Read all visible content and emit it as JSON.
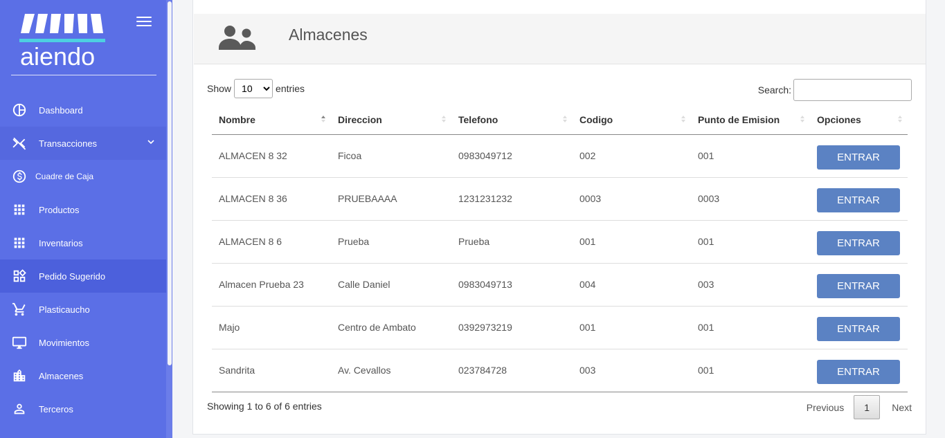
{
  "sidebar": {
    "logo_text": "aiendo",
    "items": [
      {
        "label": "Dashboard",
        "icon": "dashboard-icon"
      },
      {
        "label": "Transacciones",
        "icon": "transactions-icon"
      },
      {
        "label": "Cuadre de Caja",
        "icon": "dollar-icon"
      },
      {
        "label": "Productos",
        "icon": "grid-icon"
      },
      {
        "label": "Inventarios",
        "icon": "grid-icon"
      },
      {
        "label": "Pedido Sugerido",
        "icon": "widgets-icon"
      },
      {
        "label": "Plasticaucho",
        "icon": "cart-icon"
      },
      {
        "label": "Movimientos",
        "icon": "monitor-icon"
      },
      {
        "label": "Almacenes",
        "icon": "building-icon"
      },
      {
        "label": "Terceros",
        "icon": "person-icon"
      }
    ]
  },
  "header": {
    "title": "Almacenes",
    "icon": "users-icon"
  },
  "controls": {
    "show_label": "Show",
    "entries_label": "entries",
    "length_value": "10",
    "search_label": "Search:",
    "search_value": ""
  },
  "table": {
    "columns": [
      "Nombre",
      "Direccion",
      "Telefono",
      "Codigo",
      "Punto de Emision",
      "Opciones"
    ],
    "button_label": "ENTRAR",
    "rows": [
      {
        "nombre": "ALMACEN 8 32",
        "direccion": "Ficoa",
        "telefono": "0983049712",
        "codigo": "002",
        "punto": "001"
      },
      {
        "nombre": "ALMACEN 8 36",
        "direccion": "PRUEBAAAA",
        "telefono": "1231231232",
        "codigo": "0003",
        "punto": "0003"
      },
      {
        "nombre": "ALMACEN 8 6",
        "direccion": "Prueba",
        "telefono": "Prueba",
        "codigo": "001",
        "punto": "001"
      },
      {
        "nombre": "Almacen Prueba 23",
        "direccion": "Calle Daniel",
        "telefono": "0983049713",
        "codigo": "004",
        "punto": "003"
      },
      {
        "nombre": "Majo",
        "direccion": "Centro de Ambato",
        "telefono": "0392973219",
        "codigo": "001",
        "punto": "001"
      },
      {
        "nombre": "Sandrita",
        "direccion": "Av. Cevallos",
        "telefono": "023784728",
        "codigo": "003",
        "punto": "001"
      }
    ]
  },
  "footer": {
    "info": "Showing 1 to 6 of 6 entries",
    "previous": "Previous",
    "page": "1",
    "next": "Next"
  },
  "colors": {
    "sidebar": "#5b6fe6",
    "button": "#5b82c3"
  }
}
